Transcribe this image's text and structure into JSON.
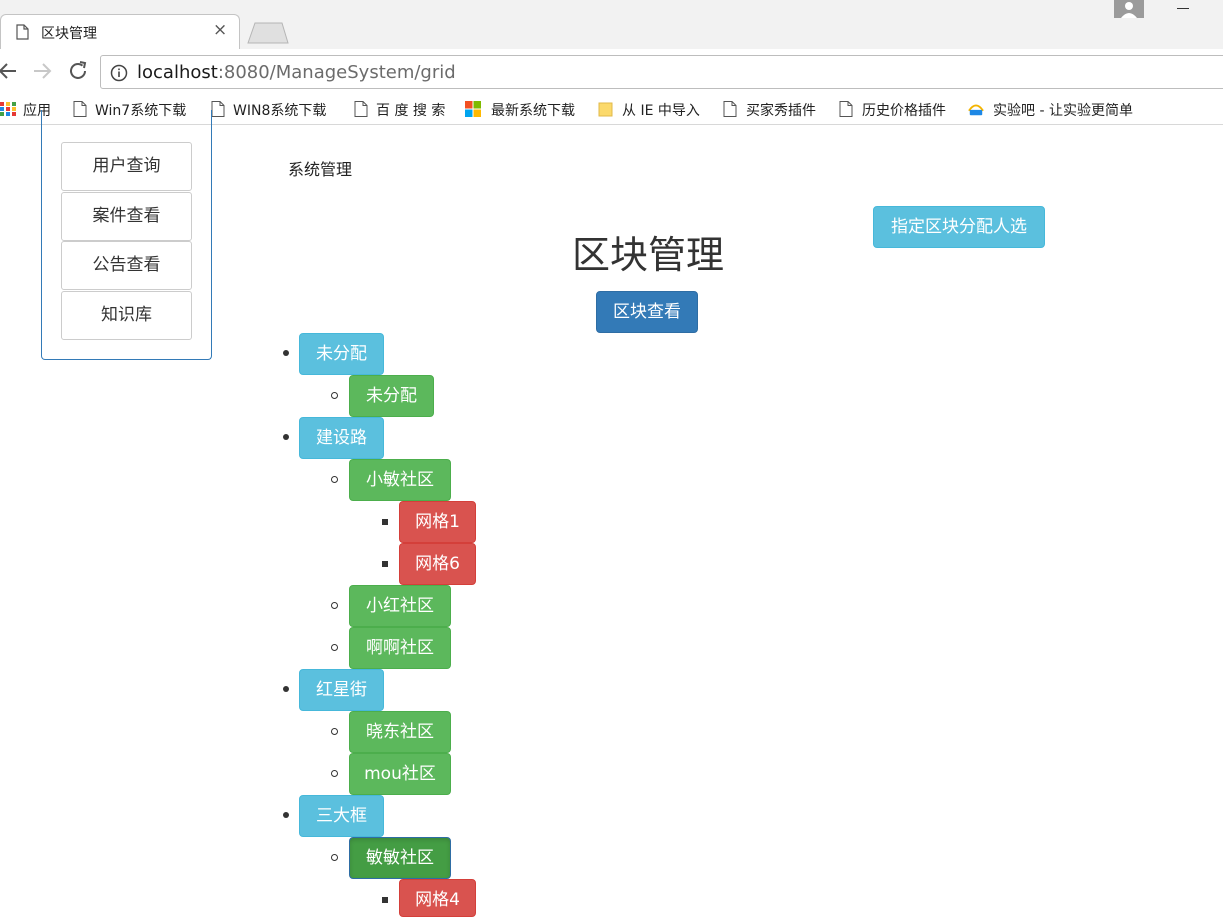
{
  "browser": {
    "tab_title": "区块管理",
    "tab_close": "×",
    "url_host": "localhost",
    "url_path": ":8080/ManageSystem/grid",
    "bookmarks": [
      {
        "label": "应用",
        "icon": "apps-grid-icon"
      },
      {
        "label": "Win7系统下载",
        "icon": "page-icon"
      },
      {
        "label": "WIN8系统下载",
        "icon": "page-icon"
      },
      {
        "label": "百 度 搜 索",
        "icon": "page-icon"
      },
      {
        "label": "最新系统下载",
        "icon": "windows-logo-icon"
      },
      {
        "label": "从 IE 中导入",
        "icon": "folder-icon"
      },
      {
        "label": "买家秀插件",
        "icon": "page-icon"
      },
      {
        "label": "历史价格插件",
        "icon": "page-icon"
      },
      {
        "label": "实验吧 - 让实验更简单",
        "icon": "site-logo-icon"
      }
    ]
  },
  "sidebar": {
    "items": [
      {
        "label": "用户查询"
      },
      {
        "label": "案件查看"
      },
      {
        "label": "公告查看"
      },
      {
        "label": "知识库"
      }
    ]
  },
  "header": {
    "system_title": "系统管理",
    "assign_button": "指定区块分配人选",
    "page_title": "区块管理",
    "view_button": "区块查看"
  },
  "tree": [
    {
      "label": "未分配",
      "children": [
        {
          "label": "未分配",
          "children": []
        }
      ]
    },
    {
      "label": "建设路",
      "children": [
        {
          "label": "小敏社区",
          "children": [
            {
              "label": "网格1"
            },
            {
              "label": "网格6"
            }
          ]
        },
        {
          "label": "小红社区",
          "children": []
        },
        {
          "label": "啊啊社区",
          "children": []
        }
      ]
    },
    {
      "label": "红星街",
      "children": [
        {
          "label": "晓东社区",
          "children": []
        },
        {
          "label": "mou社区",
          "children": []
        }
      ]
    },
    {
      "label": "三大框",
      "children": [
        {
          "label": "敏敏社区",
          "active": true,
          "children": [
            {
              "label": "网格4"
            }
          ]
        }
      ]
    }
  ],
  "colors": {
    "info": "#5bc0de",
    "success": "#5cb85c",
    "danger": "#d9534f",
    "primary": "#337ab7"
  }
}
